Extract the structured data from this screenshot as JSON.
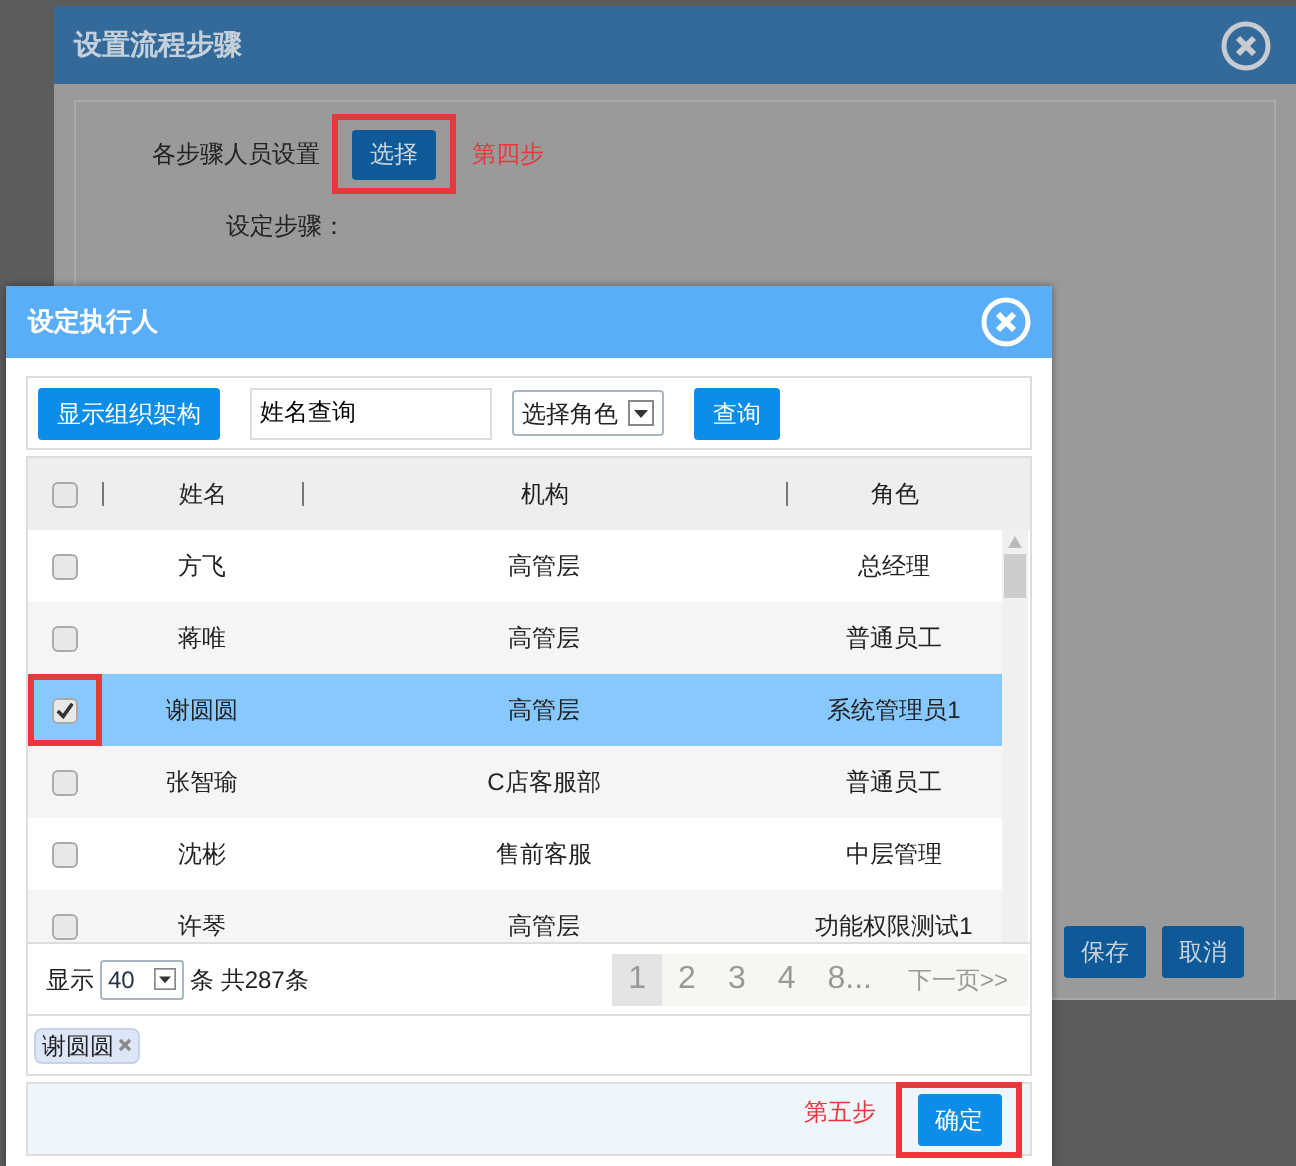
{
  "outer_dialog": {
    "title": "设置流程步骤",
    "person_setting_label": "各步骤人员设置",
    "select_button": {
      "label": "选择",
      "highlighted": true
    },
    "step_note": "第四步",
    "step_label": "设定步骤：",
    "buttons": [
      {
        "label": "保存"
      },
      {
        "label": "取消"
      }
    ]
  },
  "inner_dialog": {
    "title": "设定执行人",
    "toolbar": {
      "org_button": "显示组织架构",
      "name_search": {
        "value": "姓名查询"
      },
      "role_select": {
        "value": "选择角色"
      },
      "query_button": "查询"
    },
    "table": {
      "columns": [
        "姓名",
        "机构",
        "角色"
      ],
      "header_checked": false,
      "rows": [
        {
          "name": "方飞",
          "org": "高管层",
          "role": "总经理",
          "checked": false,
          "selected": false,
          "highlighted": false
        },
        {
          "name": "蒋唯",
          "org": "高管层",
          "role": "普通员工",
          "checked": false,
          "selected": false,
          "highlighted": false
        },
        {
          "name": "谢圆圆",
          "org": "高管层",
          "role": "系统管理员1",
          "checked": true,
          "selected": true,
          "highlighted": true
        },
        {
          "name": "张智瑜",
          "org": "C店客服部",
          "role": "普通员工",
          "checked": false,
          "selected": false,
          "highlighted": false
        },
        {
          "name": "沈彬",
          "org": "售前客服",
          "role": "中层管理",
          "checked": false,
          "selected": false,
          "highlighted": false
        },
        {
          "name": "许琴",
          "org": "高管层",
          "role": "功能权限测试1",
          "checked": false,
          "selected": false,
          "highlighted": false
        }
      ]
    },
    "pagination": {
      "show_label": "显示",
      "page_size": "40",
      "total": "条 共287条",
      "pages": [
        {
          "label": "1",
          "selected": true
        },
        {
          "label": "2",
          "selected": false
        },
        {
          "label": "3",
          "selected": false
        },
        {
          "label": "4",
          "selected": false
        },
        {
          "label": "8...",
          "selected": false
        }
      ],
      "next": "下一页>>"
    },
    "selected_tags": [
      {
        "label": "谢圆圆"
      }
    ],
    "step_note": "第五步",
    "confirm_button": {
      "label": "确定",
      "highlighted": true
    }
  }
}
